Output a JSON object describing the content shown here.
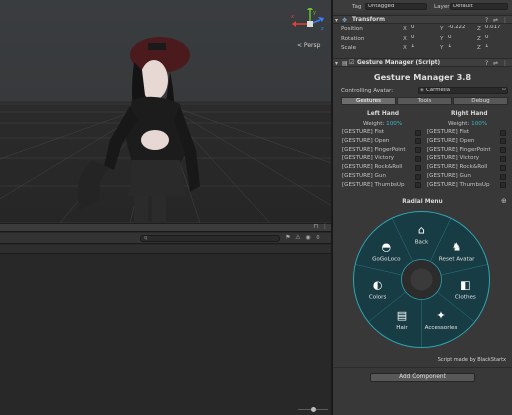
{
  "scene_view": {
    "persp_label": "< Persp",
    "gizmo_axes": {
      "x": "x",
      "y": "y",
      "z": "z"
    },
    "colors": {
      "accent_red": "#e0413b",
      "accent_green": "#66c03a",
      "accent_blue": "#3d7cff"
    }
  },
  "console": {
    "search_placeholder": "q",
    "count_badge": "0"
  },
  "inspector": {
    "top_bar": {
      "tag_label": "Tag",
      "tag_value": "Untagged",
      "layer_label": "Layer",
      "layer_value": "Default"
    },
    "transform": {
      "title": "Transform",
      "rows": [
        {
          "label": "Position",
          "x": "0",
          "y": "-0.222",
          "z": "0.017"
        },
        {
          "label": "Rotation",
          "x": "0",
          "y": "0",
          "z": "0"
        },
        {
          "label": "Scale",
          "x": "1",
          "y": "1",
          "z": "1"
        }
      ]
    },
    "script_component": {
      "title": "Gesture Manager (Script)"
    },
    "gesture_manager": {
      "title": "Gesture Manager 3.8",
      "avatar_label": "Controlling Avatar:",
      "avatar_value": "Carmella",
      "tabs": [
        "Gestures",
        "Tools",
        "Debug"
      ],
      "left_hand": {
        "title": "Left Hand",
        "weight_label": "Weight:",
        "weight_value": "100%"
      },
      "right_hand": {
        "title": "Right Hand",
        "weight_label": "Weight:",
        "weight_value": "100%"
      },
      "gestures": [
        "[GESTURE] Fist",
        "[GESTURE] Open",
        "[GESTURE] FingerPoint",
        "[GESTURE] Victory",
        "[GESTURE] Rock&Roll",
        "[GESTURE] Gun",
        "[GESTURE] ThumbsUp"
      ]
    },
    "radial_menu": {
      "title": "Radial Menu",
      "items": [
        {
          "label": "Back",
          "icon": "home-icon"
        },
        {
          "label": "Reset Avatar",
          "icon": "reset-avatar-icon"
        },
        {
          "label": "Clothes",
          "icon": "clothes-icon"
        },
        {
          "label": "Accessories",
          "icon": "accessories-icon"
        },
        {
          "label": "Hair",
          "icon": "hair-icon"
        },
        {
          "label": "Colors",
          "icon": "colors-icon"
        },
        {
          "label": "GoGoLoco",
          "icon": "gogoloco-icon"
        }
      ],
      "colors": {
        "ring": "#173c44",
        "ring_border": "#2ea4b2",
        "center": "#2c2c2c",
        "icon": "#ffffff"
      }
    },
    "credit": "Script made by BlackStartx",
    "add_component": "Add Component"
  }
}
